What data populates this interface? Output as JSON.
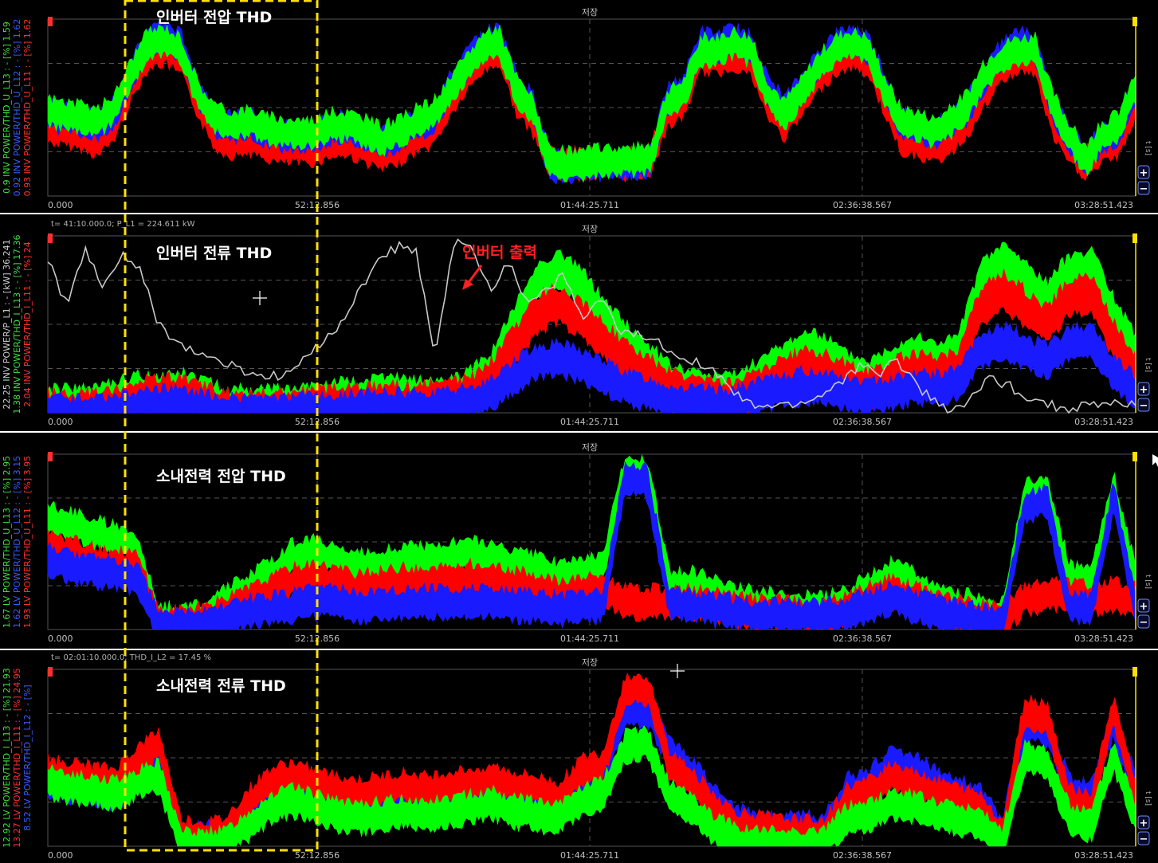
{
  "app": {
    "save_label": "저장",
    "highlight_color": "#ffe000",
    "cursor_icon": "cursor-arrow-icon",
    "zoom_in_icon": "zoom-plus-icon",
    "zoom_out_icon": "zoom-minus-icon",
    "unit_label": "t [s]"
  },
  "annotation": {
    "text": "인버터 출력",
    "color": "#ff2020"
  },
  "chart_data": [
    {
      "type": "line",
      "title": "인버터 전압 THD",
      "x_ticks": [
        "0.000",
        "52:12.856",
        "01:44:25.711",
        "02:36:38.567",
        "03:28:51.423"
      ],
      "axis_labels": [
        {
          "text": "0.9  INV POWER/THD_U_L13 : - [%]  1.59",
          "color": "#40e040"
        },
        {
          "text": "0.92  INV POWER/THD_U_L12 : - [%]  1.62",
          "color": "#3a5cff"
        },
        {
          "text": "0.93  INV POWER/THD_U_L11 : - [%]  1.62",
          "color": "#ff3030"
        }
      ],
      "cursor_readout": "",
      "series": [
        {
          "color": "#ff0000",
          "lo": 0.66,
          "hi": 0.28,
          "levels": [
            0.42,
            0.4,
            0.38,
            0.34,
            0.44,
            0.66,
            0.84,
            0.86,
            0.8,
            0.56,
            0.38,
            0.34,
            0.36,
            0.32,
            0.3,
            0.3,
            0.3,
            0.34,
            0.34,
            0.3,
            0.26,
            0.3,
            0.36,
            0.4,
            0.56,
            0.7,
            0.82,
            0.86,
            0.58,
            0.46,
            0.22,
            0.22,
            0.22,
            0.22,
            0.22,
            0.22,
            0.24,
            0.5,
            0.56,
            0.82,
            0.8,
            0.84,
            0.8,
            0.56,
            0.44,
            0.56,
            0.7,
            0.8,
            0.84,
            0.8,
            0.58,
            0.36,
            0.34,
            0.3,
            0.36,
            0.46,
            0.62,
            0.76,
            0.82,
            0.8,
            0.46,
            0.3,
            0.22,
            0.3,
            0.34,
            0.56
          ]
        },
        {
          "color": "#1a1aff",
          "lo": 0.66,
          "hi": 0.28,
          "levels": [
            0.5,
            0.48,
            0.46,
            0.44,
            0.52,
            0.72,
            0.92,
            0.94,
            0.88,
            0.62,
            0.46,
            0.42,
            0.44,
            0.4,
            0.38,
            0.38,
            0.38,
            0.42,
            0.42,
            0.38,
            0.34,
            0.38,
            0.44,
            0.48,
            0.64,
            0.78,
            0.9,
            0.92,
            0.66,
            0.54,
            0.2,
            0.2,
            0.2,
            0.22,
            0.22,
            0.22,
            0.24,
            0.58,
            0.64,
            0.9,
            0.88,
            0.92,
            0.88,
            0.64,
            0.52,
            0.64,
            0.78,
            0.88,
            0.92,
            0.88,
            0.66,
            0.44,
            0.42,
            0.38,
            0.44,
            0.54,
            0.7,
            0.84,
            0.9,
            0.88,
            0.54,
            0.36,
            0.24,
            0.36,
            0.42,
            0.64
          ]
        },
        {
          "color": "#00ff00",
          "lo": 0.66,
          "hi": 0.28,
          "levels": [
            0.52,
            0.5,
            0.48,
            0.46,
            0.54,
            0.74,
            0.9,
            0.92,
            0.86,
            0.6,
            0.48,
            0.44,
            0.46,
            0.42,
            0.4,
            0.4,
            0.4,
            0.44,
            0.44,
            0.4,
            0.36,
            0.4,
            0.46,
            0.5,
            0.62,
            0.76,
            0.88,
            0.9,
            0.64,
            0.52,
            0.22,
            0.22,
            0.22,
            0.24,
            0.24,
            0.24,
            0.26,
            0.56,
            0.62,
            0.86,
            0.86,
            0.9,
            0.86,
            0.62,
            0.5,
            0.62,
            0.76,
            0.86,
            0.9,
            0.86,
            0.64,
            0.46,
            0.44,
            0.4,
            0.46,
            0.56,
            0.72,
            0.82,
            0.86,
            0.86,
            0.56,
            0.38,
            0.24,
            0.38,
            0.44,
            0.66
          ]
        }
      ]
    },
    {
      "type": "line",
      "title": "인버터 전류 THD",
      "x_ticks": [
        "0.000",
        "52:12.856",
        "01:44:25.711",
        "02:36:38.567",
        "03:28:51.423"
      ],
      "axis_labels": [
        {
          "text": "22.25  INV POWER/P_L1 : - [kW]  36.241",
          "color": "#d0d0d0"
        },
        {
          "text": "1.38  INV POWER/THD_I_L13 : - [%]  17.36",
          "color": "#40e040"
        },
        {
          "text": "2.04  INV POWER/THD_I_L11 : - [%]  24",
          "color": "#ff3030"
        }
      ],
      "cursor_readout": "t= 41:10.000.0; P_L1 = 224.611 kW",
      "series": [
        {
          "color": "#00ff00",
          "lo": 0.75,
          "hi": 0.12,
          "levels": [
            0.1,
            0.1,
            0.1,
            0.14,
            0.18,
            0.18,
            0.2,
            0.16,
            0.1,
            0.1,
            0.1,
            0.1,
            0.12,
            0.14,
            0.14,
            0.16,
            0.16,
            0.14,
            0.16,
            0.2,
            0.32,
            0.56,
            0.8,
            0.88,
            0.78,
            0.62,
            0.48,
            0.36,
            0.24,
            0.2,
            0.18,
            0.18,
            0.26,
            0.34,
            0.42,
            0.4,
            0.3,
            0.26,
            0.34,
            0.4,
            0.36,
            0.4,
            0.8,
            0.92,
            0.82,
            0.7,
            0.86,
            0.88,
            0.62,
            0.4
          ]
        },
        {
          "color": "#ff0000",
          "lo": 0.7,
          "hi": 0.08,
          "levels": [
            0.08,
            0.08,
            0.08,
            0.1,
            0.14,
            0.16,
            0.16,
            0.12,
            0.08,
            0.08,
            0.08,
            0.08,
            0.1,
            0.1,
            0.12,
            0.12,
            0.12,
            0.12,
            0.14,
            0.16,
            0.26,
            0.44,
            0.62,
            0.68,
            0.6,
            0.48,
            0.36,
            0.28,
            0.2,
            0.16,
            0.14,
            0.14,
            0.2,
            0.26,
            0.32,
            0.3,
            0.24,
            0.2,
            0.26,
            0.3,
            0.28,
            0.32,
            0.66,
            0.76,
            0.66,
            0.56,
            0.72,
            0.74,
            0.48,
            0.3
          ]
        },
        {
          "color": "#1a1aff",
          "lo": 0.55,
          "hi": 0.05,
          "levels": [
            0.05,
            0.05,
            0.05,
            0.06,
            0.08,
            0.1,
            0.1,
            0.08,
            0.05,
            0.05,
            0.05,
            0.05,
            0.06,
            0.06,
            0.08,
            0.08,
            0.08,
            0.08,
            0.1,
            0.1,
            0.16,
            0.26,
            0.34,
            0.36,
            0.32,
            0.26,
            0.2,
            0.16,
            0.12,
            0.1,
            0.1,
            0.1,
            0.14,
            0.18,
            0.2,
            0.2,
            0.16,
            0.14,
            0.16,
            0.2,
            0.18,
            0.22,
            0.4,
            0.46,
            0.4,
            0.34,
            0.44,
            0.46,
            0.28,
            0.18
          ]
        },
        {
          "color": "#c8c8c8",
          "kind": "line",
          "levels": [
            0.88,
            0.6,
            0.92,
            0.7,
            0.9,
            0.8,
            0.5,
            0.4,
            0.34,
            0.3,
            0.26,
            0.22,
            0.2,
            0.22,
            0.3,
            0.42,
            0.52,
            0.7,
            0.88,
            0.94,
            0.9,
            0.3,
            0.96,
            0.92,
            0.7,
            0.86,
            0.62,
            0.7,
            0.78,
            0.52,
            0.64,
            0.46,
            0.44,
            0.4,
            0.34,
            0.3,
            0.24,
            0.14,
            0.04,
            0.04,
            0.04,
            0.06,
            0.1,
            0.18,
            0.26,
            0.22,
            0.3,
            0.18,
            0.06,
            0.02,
            0.06,
            0.2,
            0.16,
            0.1,
            0.06,
            0.02,
            0.04,
            0.04,
            0.06,
            0.04
          ]
        }
      ]
    },
    {
      "type": "line",
      "title": "소내전력 전압 THD",
      "x_ticks": [
        "0.000",
        "52:12.856",
        "01:44:25.711",
        "02:36:38.567",
        "03:28:51.423"
      ],
      "axis_labels": [
        {
          "text": "1.67  LV POWER/THD_U_L13 : - [%]  2.95",
          "color": "#40e040"
        },
        {
          "text": "1.62  LV POWER/THD_U_L12 : - [%]  3.15",
          "color": "#3a5cff"
        },
        {
          "text": "1.93  LV POWER/THD_U_L11 : - [%]  3.95",
          "color": "#ff3030"
        }
      ],
      "cursor_readout": "",
      "series": [
        {
          "color": "#00ff00",
          "lo": 0.74,
          "hi": 0.3,
          "levels": [
            0.68,
            0.64,
            0.6,
            0.56,
            0.52,
            0.1,
            0.1,
            0.12,
            0.2,
            0.28,
            0.36,
            0.46,
            0.48,
            0.44,
            0.4,
            0.42,
            0.44,
            0.44,
            0.46,
            0.48,
            0.46,
            0.42,
            0.4,
            0.34,
            0.36,
            0.4,
            0.96,
            0.94,
            0.3,
            0.3,
            0.26,
            0.22,
            0.18,
            0.18,
            0.16,
            0.16,
            0.2,
            0.28,
            0.36,
            0.3,
            0.22,
            0.18,
            0.16,
            0.12,
            0.8,
            0.84,
            0.34,
            0.3,
            0.86,
            0.32
          ]
        },
        {
          "color": "#ff0000",
          "lo": 0.74,
          "hi": 0.3,
          "levels": [
            0.5,
            0.48,
            0.44,
            0.42,
            0.4,
            0.08,
            0.08,
            0.1,
            0.14,
            0.2,
            0.26,
            0.32,
            0.34,
            0.32,
            0.28,
            0.3,
            0.32,
            0.3,
            0.32,
            0.34,
            0.32,
            0.3,
            0.28,
            0.24,
            0.26,
            0.28,
            0.2,
            0.2,
            0.2,
            0.2,
            0.18,
            0.16,
            0.14,
            0.14,
            0.12,
            0.12,
            0.16,
            0.22,
            0.26,
            0.22,
            0.18,
            0.14,
            0.12,
            0.1,
            0.22,
            0.24,
            0.24,
            0.22,
            0.24,
            0.22
          ]
        },
        {
          "color": "#1a1aff",
          "lo": 0.74,
          "hi": 0.3,
          "levels": [
            0.44,
            0.4,
            0.38,
            0.36,
            0.34,
            0.06,
            0.06,
            0.08,
            0.1,
            0.14,
            0.16,
            0.18,
            0.2,
            0.2,
            0.18,
            0.18,
            0.2,
            0.2,
            0.2,
            0.2,
            0.2,
            0.18,
            0.18,
            0.16,
            0.18,
            0.18,
            0.9,
            0.88,
            0.2,
            0.18,
            0.16,
            0.14,
            0.12,
            0.12,
            0.12,
            0.12,
            0.14,
            0.18,
            0.22,
            0.18,
            0.14,
            0.12,
            0.1,
            0.08,
            0.74,
            0.78,
            0.18,
            0.16,
            0.8,
            0.16
          ]
        }
      ]
    },
    {
      "type": "line",
      "title": "소내전력 전류 THD",
      "x_ticks": [
        "0.000",
        "52:12.856",
        "01:44:25.711",
        "02:36:38.567",
        "03:28:51.423"
      ],
      "axis_labels": [
        {
          "text": "12.92  LV POWER/THD_I_L13 : - [%]  21.93",
          "color": "#40e040"
        },
        {
          "text": "13.27  LV POWER/THD_I_L11 : - [%]  24.95",
          "color": "#ff3030"
        },
        {
          "text": "8.52  LV POWER/THD_I_L12 : - [%]",
          "color": "#3a5cff"
        }
      ],
      "cursor_readout": "t= 02:01:10.000.0; THD_I_L2 = 17.45 %",
      "series": [
        {
          "color": "#1a1aff",
          "lo": 0.72,
          "hi": 0.3,
          "levels": [
            0.4,
            0.38,
            0.36,
            0.34,
            0.42,
            0.5,
            0.1,
            0.08,
            0.1,
            0.22,
            0.34,
            0.38,
            0.34,
            0.3,
            0.28,
            0.3,
            0.32,
            0.3,
            0.32,
            0.34,
            0.36,
            0.32,
            0.3,
            0.28,
            0.4,
            0.44,
            0.8,
            0.82,
            0.56,
            0.46,
            0.3,
            0.18,
            0.16,
            0.14,
            0.14,
            0.14,
            0.36,
            0.4,
            0.52,
            0.48,
            0.4,
            0.36,
            0.3,
            0.12,
            0.72,
            0.7,
            0.36,
            0.32,
            0.74,
            0.38
          ]
        },
        {
          "color": "#ff0000",
          "lo": 0.72,
          "hi": 0.3,
          "levels": [
            0.46,
            0.44,
            0.42,
            0.4,
            0.52,
            0.62,
            0.12,
            0.1,
            0.12,
            0.28,
            0.4,
            0.44,
            0.4,
            0.36,
            0.34,
            0.36,
            0.38,
            0.36,
            0.38,
            0.4,
            0.42,
            0.38,
            0.36,
            0.32,
            0.46,
            0.5,
            0.92,
            0.94,
            0.5,
            0.4,
            0.26,
            0.16,
            0.14,
            0.12,
            0.12,
            0.12,
            0.3,
            0.34,
            0.44,
            0.4,
            0.34,
            0.3,
            0.26,
            0.1,
            0.8,
            0.78,
            0.3,
            0.26,
            0.82,
            0.32
          ]
        },
        {
          "color": "#00ff00",
          "lo": 0.72,
          "hi": 0.3,
          "levels": [
            0.4,
            0.38,
            0.36,
            0.34,
            0.4,
            0.44,
            0.06,
            0.04,
            0.06,
            0.16,
            0.26,
            0.3,
            0.26,
            0.22,
            0.2,
            0.22,
            0.24,
            0.22,
            0.24,
            0.26,
            0.28,
            0.24,
            0.22,
            0.2,
            0.3,
            0.34,
            0.6,
            0.62,
            0.32,
            0.26,
            0.14,
            0.08,
            0.06,
            0.06,
            0.06,
            0.06,
            0.2,
            0.22,
            0.28,
            0.26,
            0.22,
            0.2,
            0.16,
            0.06,
            0.54,
            0.52,
            0.2,
            0.16,
            0.56,
            0.2
          ]
        }
      ]
    }
  ]
}
